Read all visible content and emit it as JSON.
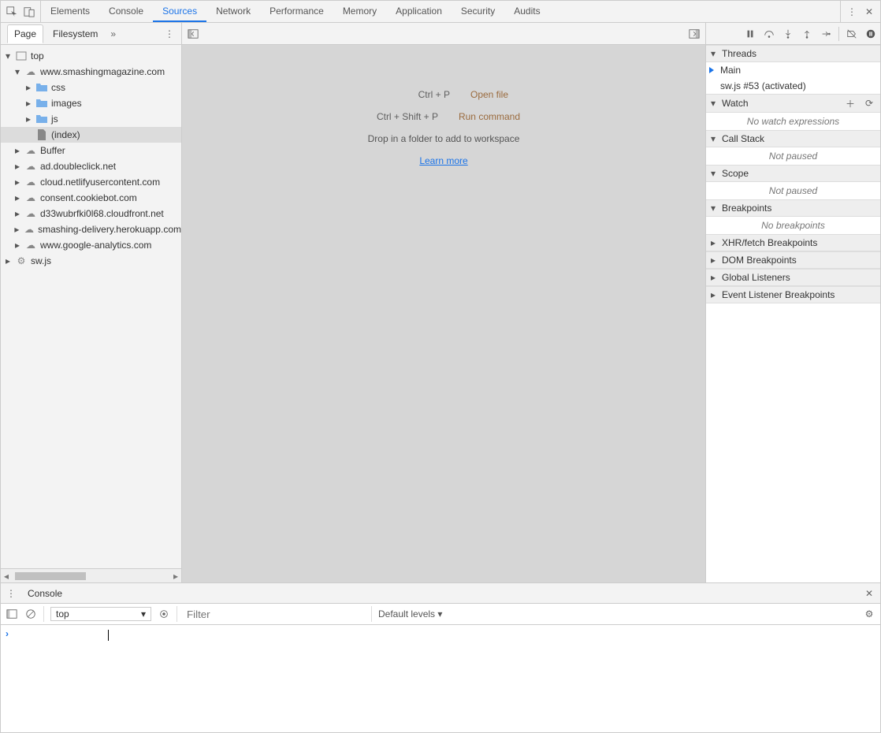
{
  "top_tabs": {
    "items": [
      "Elements",
      "Console",
      "Sources",
      "Network",
      "Performance",
      "Memory",
      "Application",
      "Security",
      "Audits"
    ],
    "selected_index": 2
  },
  "left": {
    "tabs": {
      "page": "Page",
      "filesystem": "Filesystem",
      "selected": "page"
    },
    "tree": {
      "top": "top",
      "domain": "www.smashingmagazine.com",
      "folders": [
        "css",
        "images",
        "js"
      ],
      "index": "(index)",
      "buffer": "Buffer",
      "clouds": [
        "ad.doubleclick.net",
        "cloud.netlifyusercontent.com",
        "consent.cookiebot.com",
        "d33wubrfki0l68.cloudfront.net",
        "smashing-delivery.herokuapp.com",
        "www.google-analytics.com"
      ],
      "sw": "sw.js"
    }
  },
  "editor": {
    "help_rows": [
      {
        "kbd": "Ctrl + P",
        "desc": "Open file"
      },
      {
        "kbd": "Ctrl + Shift + P",
        "desc": "Run command"
      }
    ],
    "drop_hint": "Drop in a folder to add to workspace",
    "learn_more": "Learn more"
  },
  "debugger": {
    "threads": {
      "title": "Threads",
      "main": "Main",
      "sw": "sw.js #53 (activated)"
    },
    "watch": {
      "title": "Watch",
      "empty": "No watch expressions"
    },
    "callstack": {
      "title": "Call Stack",
      "empty": "Not paused"
    },
    "scope": {
      "title": "Scope",
      "empty": "Not paused"
    },
    "breakpoints": {
      "title": "Breakpoints",
      "empty": "No breakpoints"
    },
    "xhr": {
      "title": "XHR/fetch Breakpoints"
    },
    "dom": {
      "title": "DOM Breakpoints"
    },
    "global": {
      "title": "Global Listeners"
    },
    "event": {
      "title": "Event Listener Breakpoints"
    }
  },
  "console": {
    "tab": "Console",
    "context": "top",
    "filter_placeholder": "Filter",
    "levels": "Default levels"
  }
}
